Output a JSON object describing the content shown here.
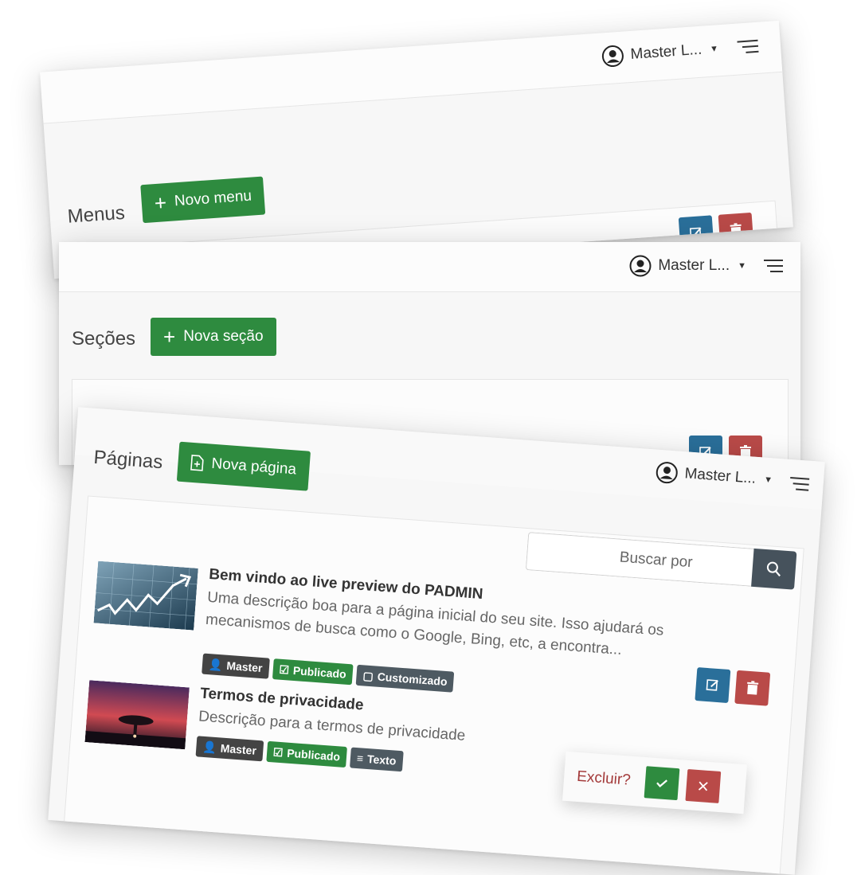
{
  "user": {
    "name": "Master L...",
    "icon": "user-circle-icon"
  },
  "menus_window": {
    "section_title": "Menus",
    "new_button": "Novo menu"
  },
  "secoes_window": {
    "section_title": "Seções",
    "new_button": "Nova seção"
  },
  "paginas_window": {
    "section_title": "Páginas",
    "new_button": "Nova página",
    "search": {
      "placeholder": "Buscar por"
    },
    "pages": [
      {
        "title": "Bem vindo ao live preview do PADMIN",
        "description": "Uma descrição boa para a página inicial do seu site. Isso ajudará os mecanismos de busca como o Google, Bing, etc, a encontra...",
        "badges": [
          "Master",
          "Publicado",
          "Customizado"
        ]
      },
      {
        "title": "Termos de privacidade",
        "description": "Descrição para a termos de privacidade",
        "badges": [
          "Master",
          "Publicado",
          "Texto"
        ]
      }
    ],
    "delete_confirm": {
      "label": "Excluir?"
    }
  },
  "colors": {
    "green": "#2e8b3f",
    "blue": "#2a6f9a",
    "red": "#b94a48",
    "dark_badge": "#444444",
    "search_button": "#46525c"
  }
}
